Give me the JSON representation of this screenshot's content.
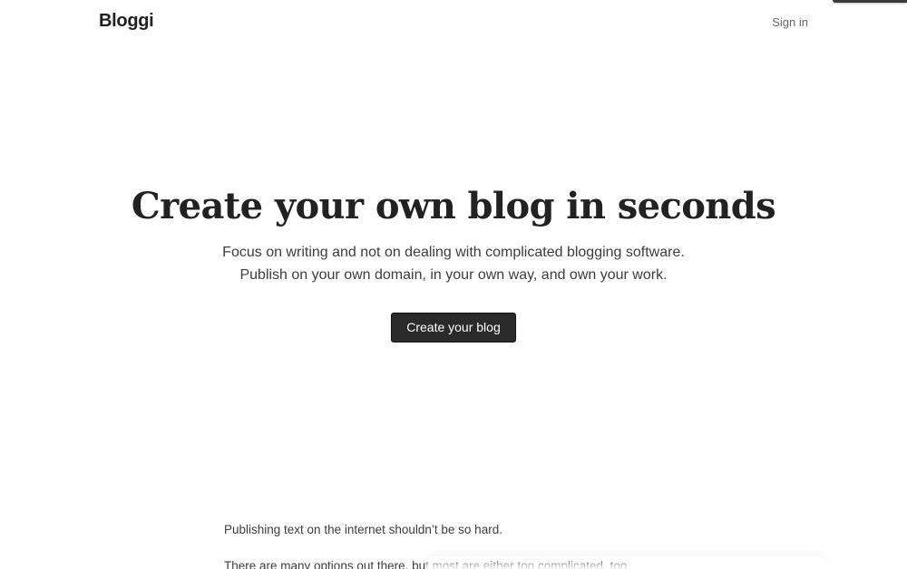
{
  "header": {
    "logo": "Bloggi",
    "sign_in": "Sign in"
  },
  "hero": {
    "title": "Create your own blog in seconds",
    "subtitle_line1": "Focus on writing and not on dealing with complicated blogging software.",
    "subtitle_line2": "Publish on your own domain, in your own way, and own your work.",
    "cta_label": "Create your blog"
  },
  "intro": {
    "paragraph1": "Publishing text on the internet shouldn’t be so hard.",
    "paragraph2": "There are many options out there, but most are either too complicated, too"
  },
  "colors": {
    "text": "#222222",
    "button_background": "#2a2a2a",
    "button_text": "#ffffff",
    "muted_text": "#666666"
  }
}
